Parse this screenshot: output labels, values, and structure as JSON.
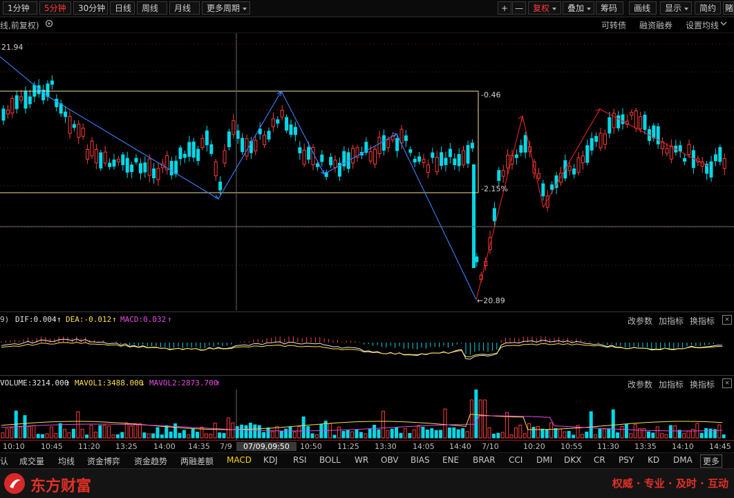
{
  "toolbar": {
    "periods": [
      "1分钟",
      "5分钟",
      "30分钟",
      "日线",
      "周线",
      "月线"
    ],
    "more_periods": "更多周期",
    "zoom_in": "+",
    "zoom_out": "—",
    "adjust": "复权",
    "overlay": "叠加",
    "chips": "筹码",
    "draw": "画线",
    "display": "显示",
    "simple": "简约",
    "cut_right": "賭"
  },
  "subbar": {
    "chart_label": "线,前复权)",
    "convertible": "可转债",
    "margin": "融资融券",
    "ma_settings": "设置均线"
  },
  "main_chart": {
    "high_label": "21.94",
    "box_top_pct": "0.46",
    "box_bottom_pct": "-2.15%",
    "low_label": "20.89",
    "colors": {
      "up": "#ff3c3c",
      "down": "#00d8e8",
      "box": "#f2e49a",
      "pen_blue": "#3a82ff",
      "pen_red": "#e02424"
    }
  },
  "macd": {
    "prefix": "9)",
    "dif": "DIF:0.004",
    "dea": "DEA:-0.012",
    "macd": "MACD:0.032",
    "edit": "改参数",
    "add": "加指标",
    "swap": "换指标",
    "close": "✕"
  },
  "volume": {
    "vol": "VOLUME:3214.000",
    "mavol1": "MAVOL1:3488.000",
    "mavol2": "MAVOL2:2873.700",
    "edit": "改参数",
    "add": "加指标",
    "swap": "换指标",
    "close": "✕"
  },
  "time_axis": [
    "10:10",
    "10:45",
    "11:20",
    "13:25",
    "14:00",
    "14:35",
    "7/9",
    "07/09,09:50",
    "10:50",
    "11:25",
    "13:30",
    "14:05",
    "14:40",
    "7/10",
    "10:20",
    "10:55",
    "11:30",
    "13:35",
    "14:10",
    "14:45"
  ],
  "tabs": [
    "认",
    "成交量",
    "均线",
    "资金博弈",
    "资金趋势",
    "两融差额",
    "MACD",
    "KDJ",
    "RSI",
    "BOLL",
    "WR",
    "OBV",
    "BIAS",
    "ENE",
    "BRAR",
    "CCI",
    "DMI",
    "DKX",
    "CR",
    "PSY",
    "KD",
    "DMA",
    "更多"
  ],
  "footer": {
    "brand": "东方财富",
    "slogan": "权威 · 专业 · 及时 · 互动"
  }
}
